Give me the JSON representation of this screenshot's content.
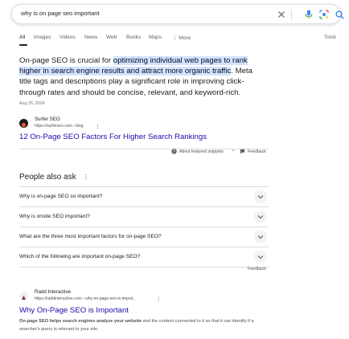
{
  "search": {
    "query": "why is on page seo important"
  },
  "tabs": [
    {
      "label": "All"
    },
    {
      "label": "Images"
    },
    {
      "label": "Videos"
    },
    {
      "label": "News"
    },
    {
      "label": "Web"
    },
    {
      "label": "Books"
    },
    {
      "label": "Maps"
    },
    {
      "label": "More"
    }
  ],
  "tools_label": "Tools",
  "featured_snippet": {
    "text_before": "On-page SEO is crucial for ",
    "highlight": "optimizing individual web pages to rank higher in search engine results and attract more organic traffic",
    "text_after": ". Meta title tags and descriptions play a significant role in improving click-through rates and should be concise, relevant, and keyword-rich.",
    "date": "Aug 26, 2024",
    "source_name": "Surfer SEO",
    "source_url": "https://surferseo.com › blog",
    "link_title": "12 On-Page SEO Factors For Higher Search Rankings",
    "about_label": "About featured snippets",
    "separator": "•",
    "feedback_label": "Feedback"
  },
  "people_also_ask": {
    "title": "People also ask",
    "questions": [
      "Why is on-page SEO so important?",
      "Why is onsite SEO important?",
      "What are the three most important factors for on-page SEO?",
      "Which of the following are important on-page SEO?"
    ],
    "feedback_label": "Feedback"
  },
  "result": {
    "source_name": "Radd Interactive",
    "source_url": "https://raddinteractive.com › why-on-page-seo-is-import...",
    "title": "Why On-Page SEO is Important",
    "desc_bold": "On-page SEO helps search engines analyze your website",
    "desc_rest": " and the content connected to it so that it can identify if a searcher's query is relevant to your site."
  },
  "colors": {
    "link": "#1a0dab",
    "highlight": "#d3e3fd",
    "accent_blue": "#1a73e8"
  }
}
